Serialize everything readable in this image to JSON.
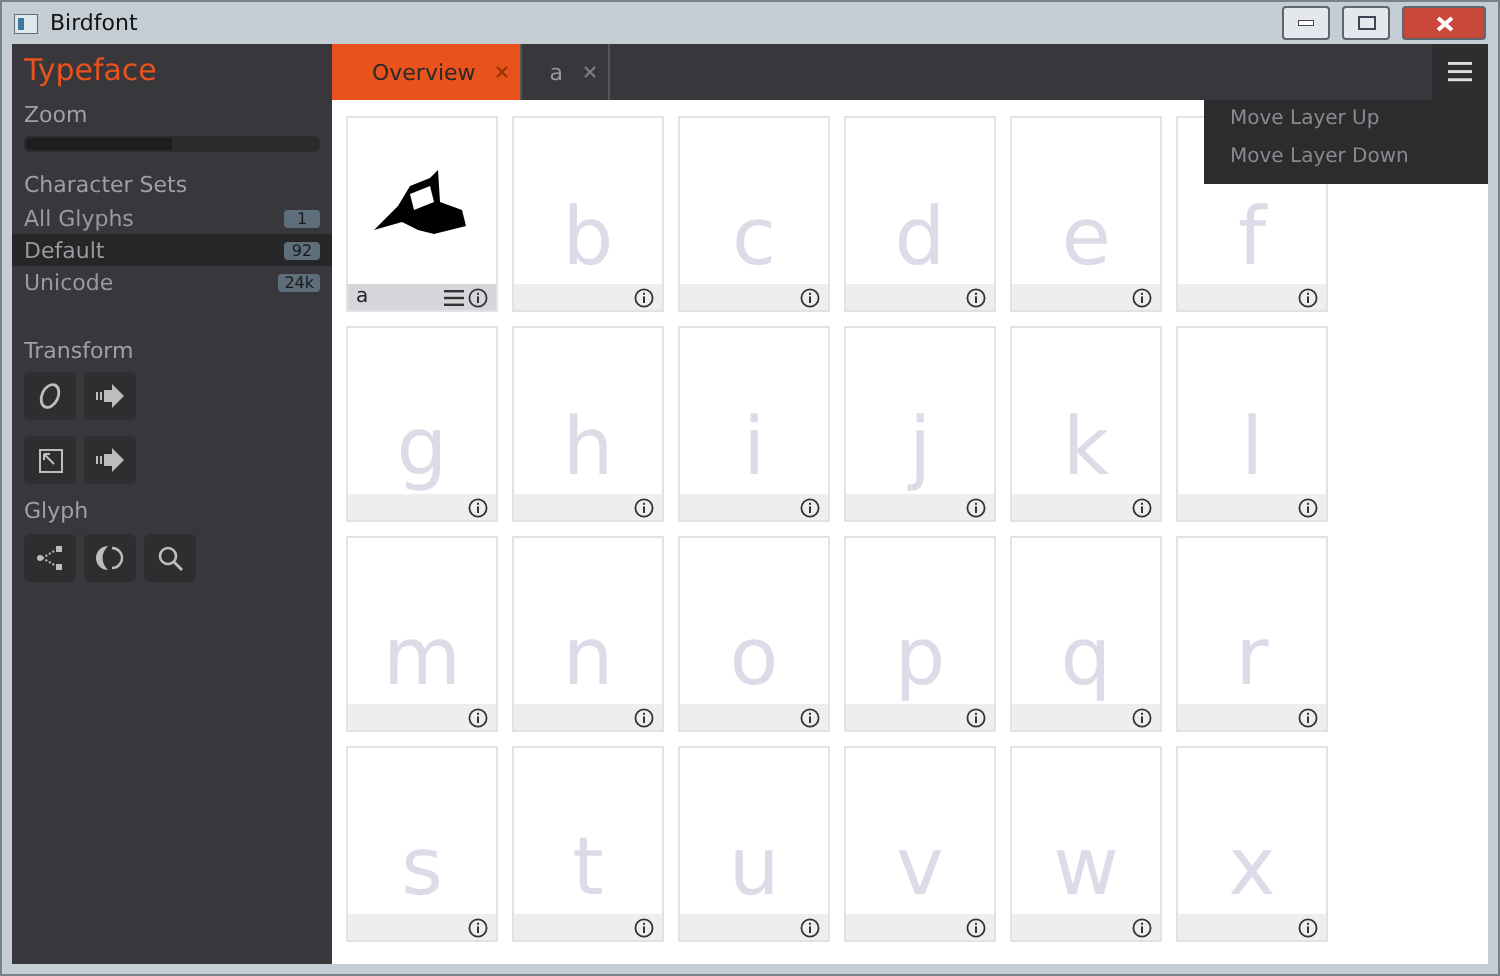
{
  "window": {
    "title": "Birdfont"
  },
  "sidebar": {
    "title": "Typeface",
    "zoom": {
      "label": "Zoom",
      "level": 0.5
    },
    "character_sets": {
      "heading": "Character Sets",
      "items": [
        {
          "label": "All Glyphs",
          "count": "1",
          "selected": false
        },
        {
          "label": "Default",
          "count": "92",
          "selected": true
        },
        {
          "label": "Unicode",
          "count": "24k",
          "selected": false
        }
      ]
    },
    "transform": {
      "heading": "Transform",
      "tools": [
        {
          "kind": "oblique"
        },
        {
          "kind": "arrow"
        },
        {
          "kind": "resize"
        },
        {
          "kind": "arrow"
        }
      ]
    },
    "glyph": {
      "heading": "Glyph",
      "tools": [
        {
          "kind": "nodes"
        },
        {
          "kind": "rotate"
        },
        {
          "kind": "zoom"
        }
      ]
    }
  },
  "tabs": [
    {
      "label": "Overview",
      "selected": true
    },
    {
      "label": "a",
      "selected": false
    }
  ],
  "menu": {
    "items": [
      "Move Layer Up",
      "Move Layer Down"
    ]
  },
  "glyphs": [
    {
      "kind": "drawn",
      "label": "a"
    },
    {
      "kind": "empty",
      "character": "b"
    },
    {
      "kind": "empty",
      "character": "c"
    },
    {
      "kind": "empty",
      "character": "d"
    },
    {
      "kind": "empty",
      "character": "e"
    },
    {
      "kind": "empty",
      "character": "f"
    },
    {
      "kind": "empty",
      "character": "g"
    },
    {
      "kind": "empty",
      "character": "h"
    },
    {
      "kind": "empty",
      "character": "i"
    },
    {
      "kind": "empty",
      "character": "j"
    },
    {
      "kind": "empty",
      "character": "k"
    },
    {
      "kind": "empty",
      "character": "l"
    },
    {
      "kind": "empty",
      "character": "m"
    },
    {
      "kind": "empty",
      "character": "n"
    },
    {
      "kind": "empty",
      "character": "o"
    },
    {
      "kind": "empty",
      "character": "p"
    },
    {
      "kind": "empty",
      "character": "q"
    },
    {
      "kind": "empty",
      "character": "r"
    },
    {
      "kind": "empty",
      "character": "s"
    },
    {
      "kind": "empty",
      "character": "t"
    },
    {
      "kind": "empty",
      "character": "u"
    },
    {
      "kind": "empty",
      "character": "v"
    },
    {
      "kind": "empty",
      "character": "w"
    },
    {
      "kind": "empty",
      "character": "x"
    }
  ]
}
